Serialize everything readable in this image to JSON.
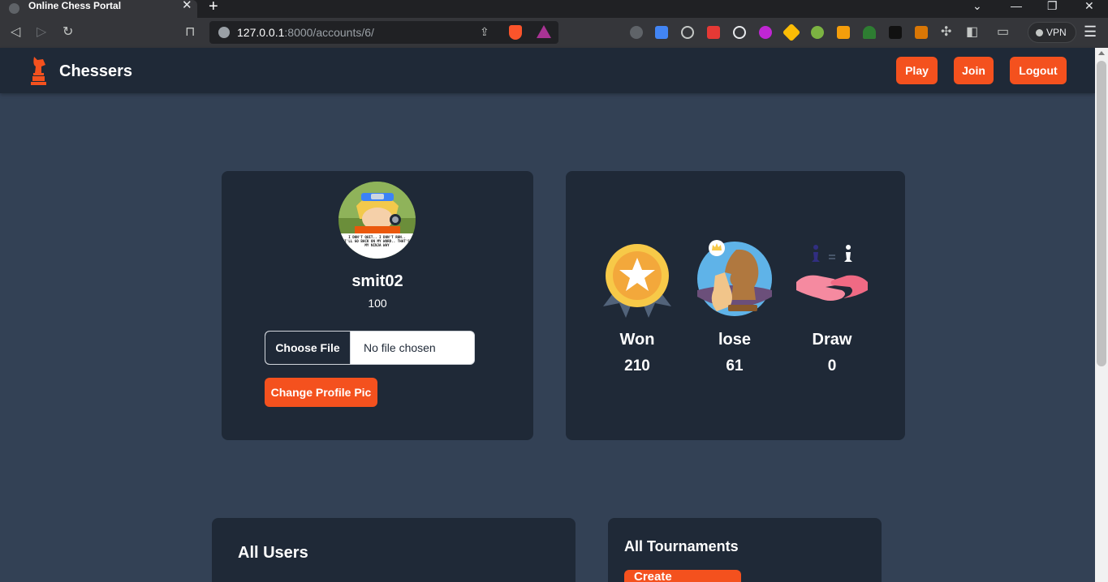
{
  "browser": {
    "tab_title": "Online Chess Portal",
    "new_tab_icon": "+",
    "close_icon": "✕",
    "url_host": "127.0.0.1",
    "url_path": ":8000/accounts/6/",
    "vpn_label": "VPN"
  },
  "app": {
    "brand": "Chessers",
    "nav": {
      "play": "Play",
      "join": "Join",
      "logout": "Logout"
    }
  },
  "profile": {
    "username": "smit02",
    "rating": "100",
    "file_button": "Choose File",
    "file_status": "No file chosen",
    "change_pic_label": "Change Profile Pic",
    "avatar_caption": "I DON'T QUIT.. I DON'T RUN.. I'LL GO BACK ON MY WORD.. THAT'S MY NINJA WAY"
  },
  "stats": [
    {
      "label": "Won",
      "value": "210",
      "icon": "medal-icon"
    },
    {
      "label": "lose",
      "value": "61",
      "icon": "chess-pieces-icon"
    },
    {
      "label": "Draw",
      "value": "0",
      "icon": "handshake-icon"
    }
  ],
  "sections": {
    "users_title": "All Users",
    "tournaments_title": "All Tournaments",
    "tournament_button": "Create tournament"
  },
  "colors": {
    "accent": "#f4511e",
    "page_bg": "#334155",
    "card_bg": "#1f2937"
  }
}
